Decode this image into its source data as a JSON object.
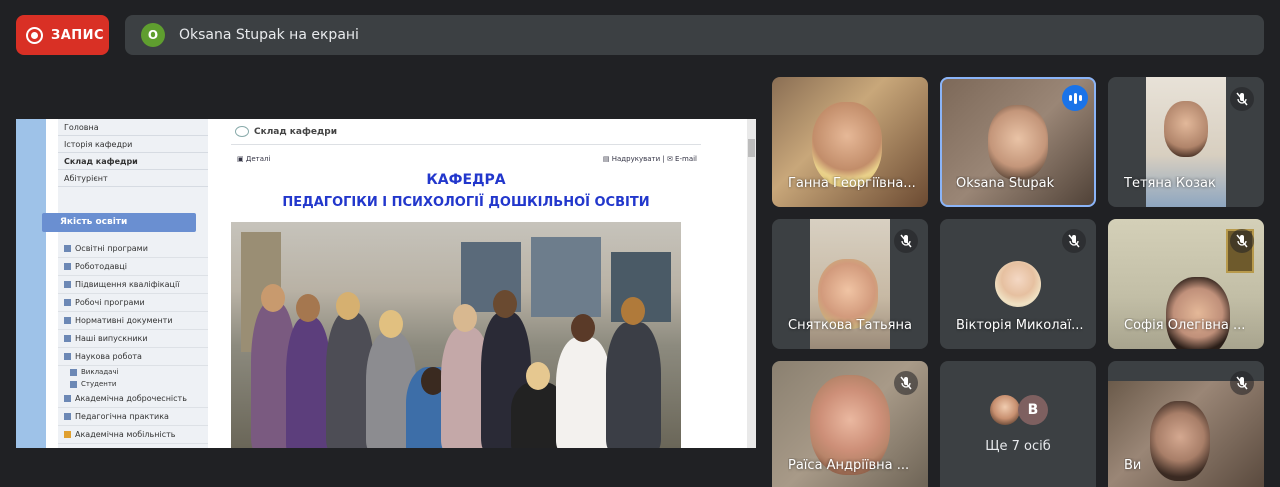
{
  "recording": {
    "label": "ЗАПИС"
  },
  "presentation": {
    "avatar_letter": "O",
    "text": "Oksana Stupak на екрані"
  },
  "shared_screen": {
    "nav_items": [
      "Головна",
      "Історія кафедри",
      "Склад кафедри",
      "Абітурієнт"
    ],
    "quality_header": "Якість освіти",
    "quality_items": [
      "Освітні програми",
      "Роботодавці",
      "Підвищення кваліфікації",
      "Робочі програми",
      "Нормативні документи",
      "Наші випускники",
      "Наукова робота"
    ],
    "research_sub": [
      "Викладачі",
      "Студенти"
    ],
    "quality_items_2": [
      "Академічна доброчесність",
      "Педагогічна практика",
      "Академічна мобільність"
    ],
    "page_header": "Склад кафедри",
    "details_link": "Деталі",
    "print_link": "Надрукувати",
    "email_link": "E-mail",
    "title_line1": "КАФЕДРА",
    "title_line2": "ПЕДАГОГІКИ І ПСИХОЛОГІЇ ДОШКІЛЬНОЇ ОСВІТИ"
  },
  "participants": [
    {
      "name": "Ганна Георгіївна..."
    },
    {
      "name": "Oksana Stupak"
    },
    {
      "name": "Тетяна Козак"
    },
    {
      "name": "Сняткова Татьяна"
    },
    {
      "name": "Вікторія Миколаї..."
    },
    {
      "name": "Софія Олегівна ..."
    },
    {
      "name": "Раїса Андріївна ..."
    },
    {
      "name": "Ви"
    }
  ],
  "more": {
    "avatar_letter": "В",
    "text": "Ще 7 осіб"
  },
  "colors": {
    "record": "#d93025",
    "active_speaker": "#1a73e8",
    "background": "#202124",
    "bar": "#3c4043"
  }
}
